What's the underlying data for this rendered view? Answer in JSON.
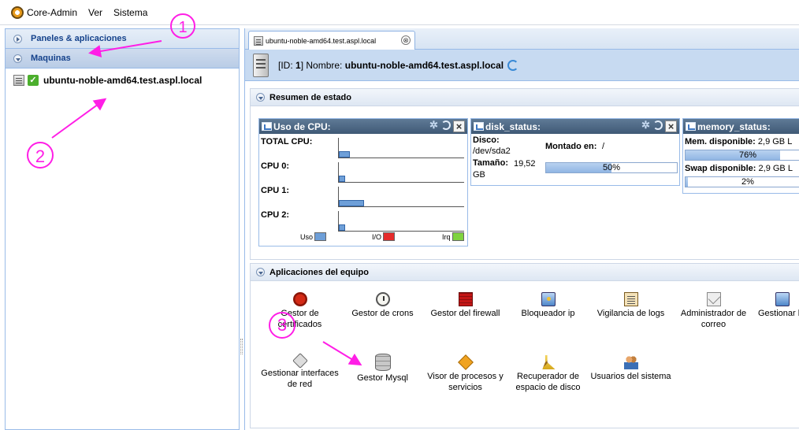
{
  "menubar": {
    "app_name": "Core-Admin",
    "items": [
      "Ver",
      "Sistema"
    ]
  },
  "sidebar": {
    "sections": [
      {
        "label": "Paneles & aplicaciones"
      },
      {
        "label": "Maquinas"
      }
    ],
    "tree": [
      {
        "label": "ubuntu-noble-amd64.test.aspl.local",
        "status": "ok"
      }
    ]
  },
  "tab": {
    "label": "ubuntu-noble-amd64.test.aspl.local",
    "close": "⊗"
  },
  "machine": {
    "id_label": "[ID:",
    "id_value": "1",
    "name_label": "] Nombre:",
    "name": "ubuntu-noble-amd64.test.aspl.local"
  },
  "status_section": {
    "title": "Resumen de estado",
    "cpu_widget": {
      "title": "Uso de CPU:",
      "rows": [
        {
          "label": "TOTAL CPU:",
          "uso": 9
        },
        {
          "label": "CPU 0:",
          "uso": 5
        },
        {
          "label": "CPU 1:",
          "uso": 20
        },
        {
          "label": "CPU 2:",
          "uso": 5
        }
      ],
      "legend": [
        {
          "label": "Uso",
          "color": "#6e9fd8"
        },
        {
          "label": "I/O",
          "color": "#e52b2b"
        },
        {
          "label": "Irq",
          "color": "#7fd340"
        }
      ]
    },
    "disk_widget": {
      "title": "disk_status:",
      "disco_label": "Disco:",
      "disco_value": "/dev/sda2",
      "montado_label": "Montado en:",
      "montado_value": "/",
      "tamano_label": "Tamaño:",
      "tamano_value": "19,52 GB",
      "percent": 50,
      "percent_text": "50%"
    },
    "memory_widget": {
      "title": "memory_status:",
      "mem_label": "Mem. disponible:",
      "mem_value": "2,9 GB L",
      "mem_percent": 76,
      "mem_percent_text": "76%",
      "swap_label": "Swap disponible:",
      "swap_value": "2,9 GB L",
      "swap_percent": 2,
      "swap_percent_text": "2%"
    }
  },
  "apps_section": {
    "title": "Aplicaciones del equipo",
    "apps": [
      {
        "label": "Gestor de certificados",
        "icon": "certificate-icon"
      },
      {
        "label": "Gestor de crons",
        "icon": "clock-icon"
      },
      {
        "label": "Gestor del firewall",
        "icon": "firewall-icon"
      },
      {
        "label": "Bloqueador ip",
        "icon": "monitor-lock-icon"
      },
      {
        "label": "Vigilancia de logs",
        "icon": "clipboard-icon"
      },
      {
        "label": "Administrador de correo",
        "icon": "mail-icon"
      },
      {
        "label": "Gestionar host",
        "icon": "monitor-icon"
      },
      {
        "label": "Gestionar interfaces de red",
        "icon": "network-icon"
      },
      {
        "label": "Gestor Mysql",
        "icon": "database-icon"
      },
      {
        "label": "Visor de procesos y servicios",
        "icon": "process-icon"
      },
      {
        "label": "Recuperador de espacio de disco",
        "icon": "broom-icon"
      },
      {
        "label": "Usuarios del sistema",
        "icon": "users-icon"
      }
    ]
  },
  "annotations": {
    "color": "#ff1ee6",
    "labels": [
      "1",
      "2",
      "3"
    ]
  }
}
